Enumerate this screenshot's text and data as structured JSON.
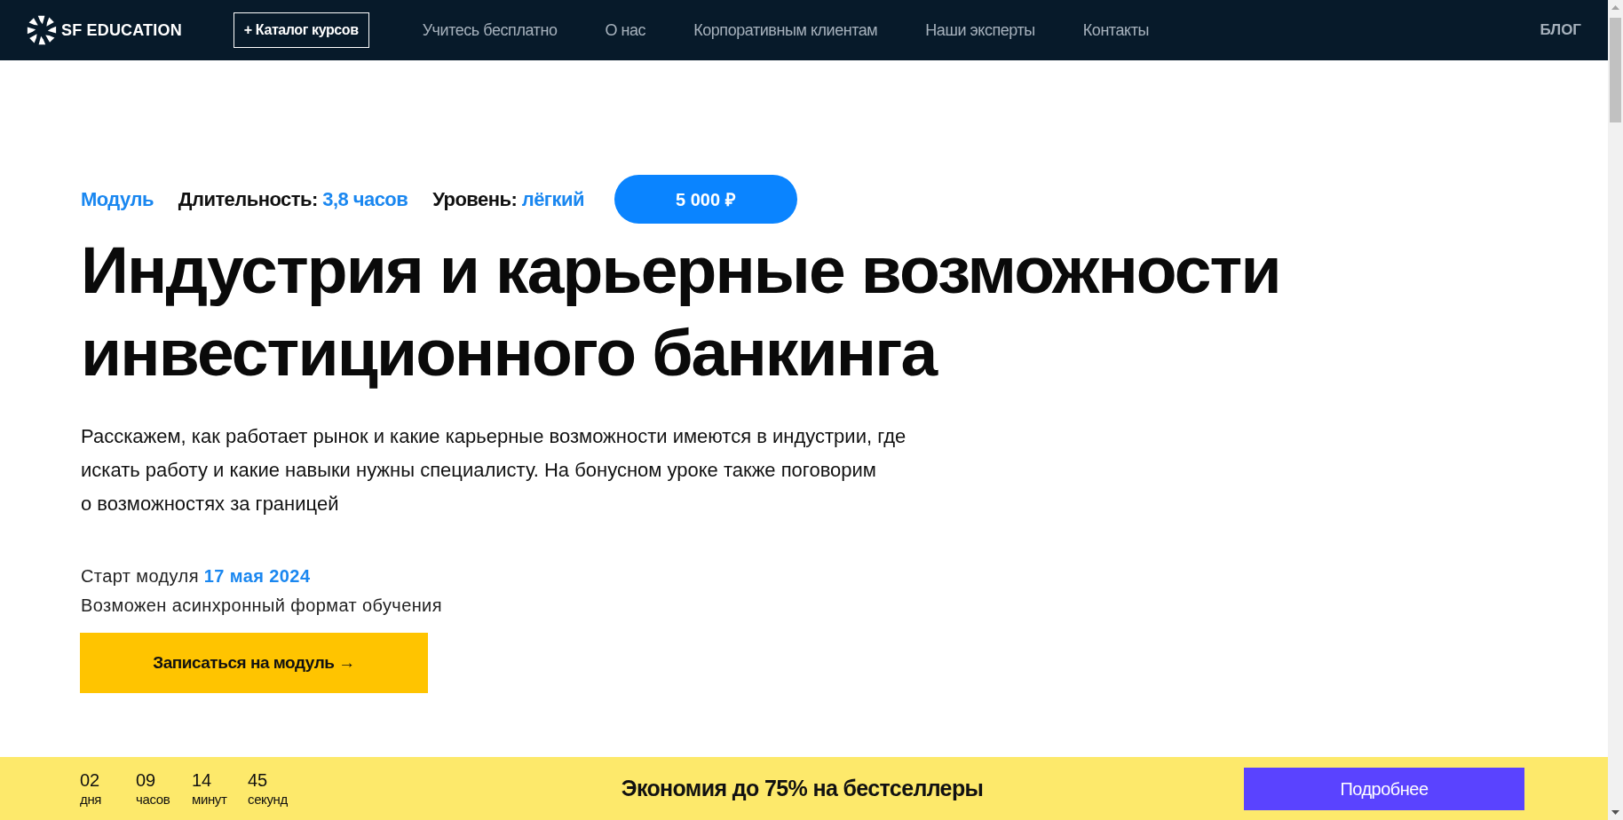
{
  "nav": {
    "logo": "SF EDUCATION",
    "catalog_button": "+ Каталог курсов",
    "links": [
      "Учитесь бесплатно",
      "О нас",
      "Корпоративным клиентам",
      "Наши эксперты",
      "Контакты"
    ],
    "blog": "БЛОГ"
  },
  "hero": {
    "type": "Модуль",
    "meta": [
      {
        "label": "Длительность:",
        "value": "3,8 часов"
      },
      {
        "label": "Уровень:",
        "value": "лёгкий"
      }
    ],
    "price": "5 000 ₽",
    "title": "Индустрия и карьерные возможности инвестиционного банкинга",
    "description": "Расскажем, как работает рынок и какие карьерные возможности имеются в индустрии, где искать работу и какие навыки нужны специалисту. На бонусном уроке также поговорим о возможностях за границей",
    "start_label": "Старт модуля",
    "start_date": "17 мая 2024",
    "format_note": "Возможен асинхронный формат обучения",
    "cta": "Записаться на модуль →"
  },
  "promo_banner": {
    "countdown": [
      {
        "value": "02",
        "unit": "дня"
      },
      {
        "value": "09",
        "unit": "часов"
      },
      {
        "value": "14",
        "unit": "минут"
      },
      {
        "value": "45",
        "unit": "секунд"
      }
    ],
    "text": "Экономия до 75% на бестселлеры",
    "button": "Подробнее"
  }
}
